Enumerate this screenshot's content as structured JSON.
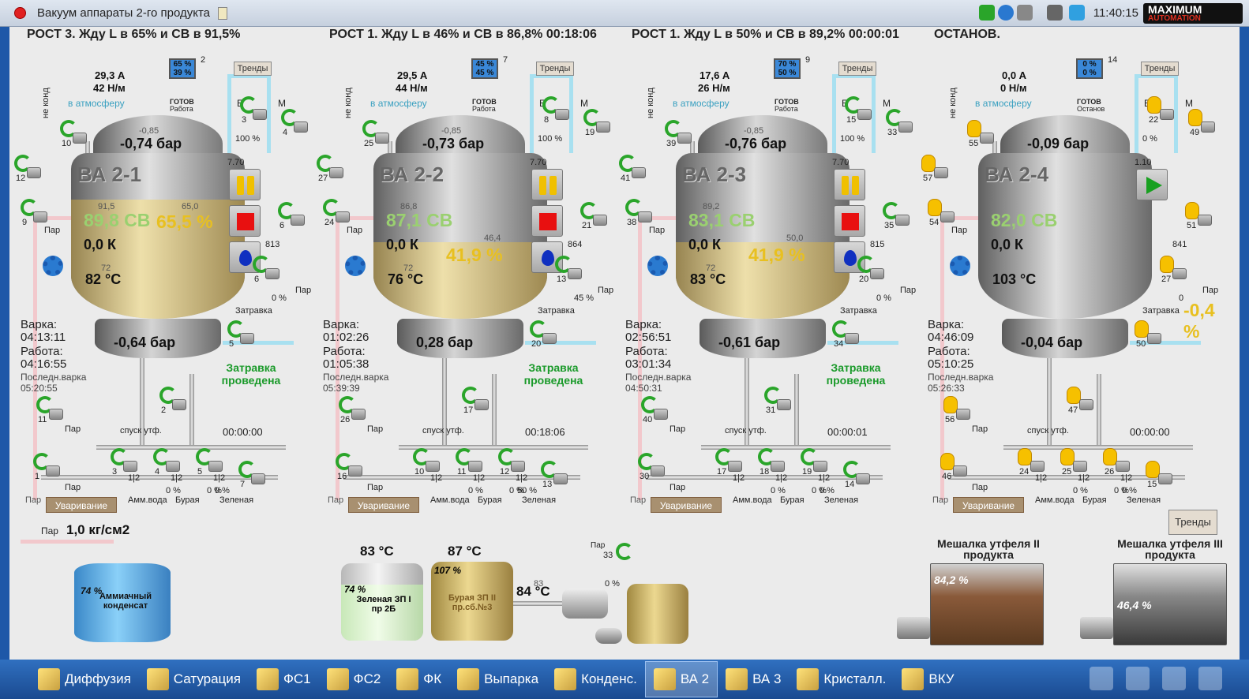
{
  "window": {
    "title": "Вакуум аппараты 2-го продукта",
    "time": "11:40:15",
    "logo_top": "MAXIMUM",
    "logo_bottom": "AUTOMATION"
  },
  "status": [
    "РОСТ 3.  Жду L в 65%  и СВ в 91,5%",
    "РОСТ 1.  Жду L в 46%  и СВ в 86,8% 00:18:06",
    "РОСТ 1.  Жду L в 50%  и СВ в 89,2% 00:00:01",
    "ОСТАНОВ."
  ],
  "common": {
    "trends": "Тренды",
    "atmosphere": "в атмосферу",
    "ready": "ГОТОВ",
    "ne_kond": "не конд",
    "par": "Пар",
    "zatravka": "Затравка",
    "zatravka_done": "Затравка проведена",
    "varka": "Варка:",
    "rabota": "Работа:",
    "posledn": "Последн.варка",
    "spusk": "спуск утф.",
    "uvarivanie": "Уваривание",
    "amm": "Амм.вода",
    "buraya": "Бурая",
    "zelenaya": "Зеленая",
    "b": "Б",
    "m": "М",
    "ratio": "1|2"
  },
  "units": [
    {
      "name": "ВА 2-1",
      "amps": "29,3 А",
      "force": "42 Н/м",
      "mon1": "65 %",
      "mon2": "39 %",
      "mon_num": "2",
      "state": "Работа",
      "press_top": "-0,74 бар",
      "press_top_small": "-0,85",
      "cv": "89,8 СВ",
      "cv_small": "91,5",
      "level": "65,5 %",
      "level_small": "65,0",
      "k": "0,0 К",
      "temp": "82 °С",
      "temp_small": "72",
      "press_bot": "-0,64 бар",
      "setp": "7.70",
      "flow": "813",
      "v_top": "1",
      "v_b": "3",
      "v_m": "4",
      "v_nk": "10",
      "v_left": "12",
      "v_par": "9",
      "v_6": "6",
      "v_zatr": "6",
      "v_zatr_pct": "0 %",
      "v_pct100": "100 %",
      "v_5": "5",
      "v_11": "11",
      "v_1": "1",
      "v_2": "2",
      "v_3": "3",
      "v_4": "4",
      "v_5b": "5",
      "v_7": "7",
      "pcts": [
        "0 %",
        "0 %",
        "0 %"
      ],
      "varka": "04:13:11",
      "rabota": "04:16:55",
      "posledn": "05:20:55",
      "timer": "00:00:00",
      "btn": "pause"
    },
    {
      "name": "ВА 2-2",
      "amps": "29,5 А",
      "force": "44 Н/м",
      "mon1": "45 %",
      "mon2": "45 %",
      "mon_num": "7",
      "state": "Работа",
      "press_top": "-0,73 бар",
      "press_top_small": "-0,85",
      "cv": "87,1 СВ",
      "cv_small": "86,8",
      "level": "41,9 %",
      "level_small": "46,4",
      "k": "0,0 К",
      "temp": "76 °С",
      "temp_small": "72",
      "press_bot": "0,28 бар",
      "setp": "7.70",
      "flow": "864",
      "v_top": "",
      "v_b": "8",
      "v_m": "19",
      "v_nk": "25",
      "v_left": "27",
      "v_par": "24",
      "v_6": "21",
      "v_zatr": "13",
      "v_zatr_pct": "45 %",
      "v_pct100": "100 %",
      "v_5": "20",
      "v_11": "26",
      "v_1": "16",
      "v_2": "17",
      "v_3": "10",
      "v_4": "11",
      "v_5b": "12",
      "v_7": "13",
      "pcts": [
        "0 %",
        "0 %",
        "50 %"
      ],
      "varka": "01:02:26",
      "rabota": "01:05:38",
      "posledn": "05:39:39",
      "timer": "00:18:06",
      "btn": "pause"
    },
    {
      "name": "ВА 2-3",
      "amps": "17,6 А",
      "force": "26 Н/м",
      "mon1": "70 %",
      "mon2": "50 %",
      "mon_num": "9",
      "state": "Работа",
      "press_top": "-0,76 бар",
      "press_top_small": "-0,85",
      "cv": "83,1 СВ",
      "cv_small": "89,2",
      "level": "41,9 %",
      "level_small": "50,0",
      "k": "0,0 К",
      "temp": "83 °С",
      "temp_small": "72",
      "press_bot": "-0,61 бар",
      "setp": "7.70",
      "flow": "815",
      "v_top": "",
      "v_b": "15",
      "v_m": "33",
      "v_nk": "39",
      "v_left": "41",
      "v_par": "38",
      "v_6": "35",
      "v_zatr": "20",
      "v_zatr_pct": "0 %",
      "v_pct100": "100 %",
      "v_5": "34",
      "v_11": "40",
      "v_1": "30",
      "v_2": "31",
      "v_3": "17",
      "v_4": "18",
      "v_5b": "19",
      "v_7": "14",
      "pcts": [
        "0 %",
        "0 %",
        "0 %"
      ],
      "varka": "02:56:51",
      "rabota": "03:01:34",
      "posledn": "04:50:31",
      "timer": "00:00:01",
      "btn": "pause"
    },
    {
      "name": "ВА 2-4",
      "amps": "0,0 А",
      "force": "0 Н/м",
      "mon1": "0 %",
      "mon2": "0 %",
      "mon_num": "14",
      "state": "Останов",
      "press_top": "-0,09 бар",
      "press_top_small": "",
      "cv": "82,0 СВ",
      "cv_small": "",
      "level": "-0,4 %",
      "level_small": "",
      "k": "0,0 К",
      "temp": "103 °С",
      "temp_small": "",
      "press_bot": "-0,04 бар",
      "setp": "1.10",
      "flow": "841",
      "v_top": "",
      "v_b": "22",
      "v_m": "49",
      "v_nk": "55",
      "v_left": "57",
      "v_par": "54",
      "v_6": "51",
      "v_zatr": "27",
      "v_zatr_pct": "0",
      "v_pct100": "0 %",
      "v_5": "50",
      "v_11": "56",
      "v_1": "46",
      "v_2": "47",
      "v_3": "24",
      "v_4": "25",
      "v_5b": "26",
      "v_7": "15",
      "pcts": [
        "0 %",
        "0 %",
        "0 %"
      ],
      "varka": "04:46:09",
      "rabota": "05:10:25",
      "posledn": "05:26:33",
      "timer": "00:00:00",
      "btn": "play"
    }
  ],
  "bottom": {
    "par_label": "Пар",
    "par_value": "1,0 кг/см2",
    "amm_tank_pct": "74 %",
    "amm_tank_label": "Аммиачный конденсат",
    "green_temp": "83 °С",
    "green_pct": "74 %",
    "green_label": "Зеленая ЗП I пр 2Б",
    "brown_temp": "87 °С",
    "brown_pct": "107 %",
    "brown_label": "Бурая ЗП II пр.сб.№3",
    "heater_temp": "84 °С",
    "heater_small": "83",
    "valve33": "33",
    "valve33_pct": "0 %",
    "valve33_par": "Пар",
    "trends": "Тренды",
    "mixer2_title": "Мешалка утфеля II продукта",
    "mixer2_pct": "84,2 %",
    "mixer3_title": "Мешалка утфеля III продукта",
    "mixer3_pct": "46,4 %"
  },
  "taskbar": [
    "Диффузия",
    "Сатурация",
    "ФС1",
    "ФС2",
    "ФК",
    "Выпарка",
    "Конденс.",
    "ВА 2",
    "ВА 3",
    "Кристалл.",
    "ВКУ"
  ],
  "taskbar_active": "ВА 2",
  "colors": {
    "fill": "#e8d8a0",
    "cv": "#9ad070",
    "level": "#e8c020",
    "ok": "#1a9a2a"
  }
}
